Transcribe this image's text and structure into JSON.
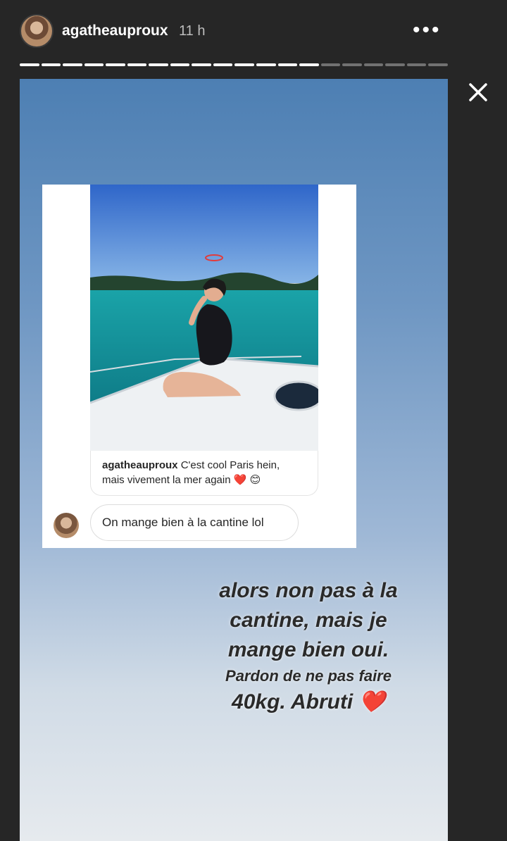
{
  "header": {
    "username": "agatheauproux",
    "time": "11 h",
    "more_glyph": "•••",
    "progress_segments": 20,
    "progress_completed": 14
  },
  "icons": {
    "avatar": "user-avatar",
    "more": "more-options-icon",
    "close": "close-icon"
  },
  "post": {
    "caption_user": "agatheauproux",
    "caption_text_1": "C'est cool Paris hein,",
    "caption_text_2": "mais vivement la mer again",
    "caption_emoji_heart": "❤️",
    "caption_emoji_smile": "😊",
    "reply_text": "On mange bien à la cantine lol"
  },
  "overlay": {
    "line1": "alors non pas à la",
    "line2": "cantine, mais je",
    "line3": "mange bien oui.",
    "line4": "Pardon de ne pas faire",
    "line5": "40kg. Abruti",
    "heart": "❤️"
  },
  "colors": {
    "background": "#262626",
    "sky_top": "#4d7fb3",
    "heart": "#e0263b"
  }
}
